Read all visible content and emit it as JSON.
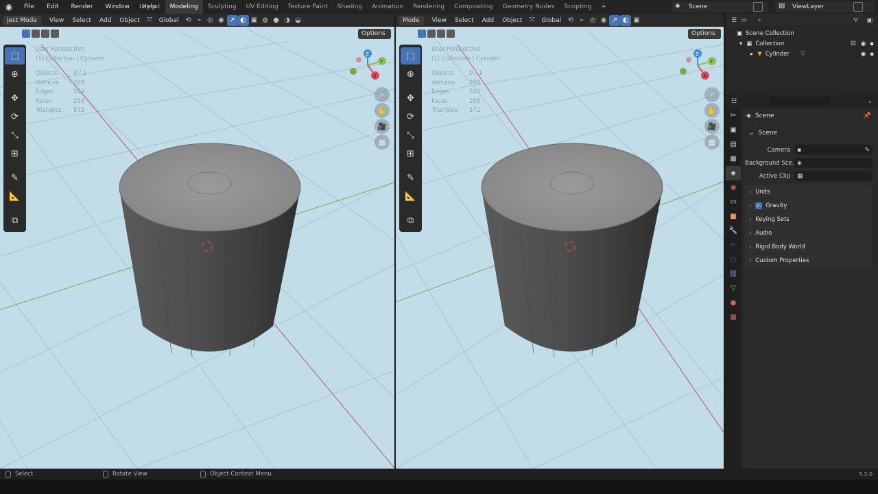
{
  "menu": [
    "File",
    "Edit",
    "Render",
    "Window",
    "Help"
  ],
  "workspaces": [
    "Layout",
    "Modeling",
    "Sculpting",
    "UV Editing",
    "Texture Paint",
    "Shading",
    "Animation",
    "Rendering",
    "Compositing",
    "Geometry Nodes",
    "Scripting",
    "+"
  ],
  "active_workspace": "Modeling",
  "scene_name": "Scene",
  "view_layer": "ViewLayer",
  "viewport_left": {
    "mode": "ject Mode",
    "view": "View",
    "select": "Select",
    "add": "Add",
    "object": "Object",
    "orientation": "Global",
    "options": "Options",
    "perspective": "User Perspective",
    "collection": "(1) Collection | Cylinder",
    "stats": [
      {
        "k": "Objects",
        "v": "0 / 1"
      },
      {
        "k": "Vertices",
        "v": "288"
      },
      {
        "k": "Edges",
        "v": "544"
      },
      {
        "k": "Faces",
        "v": "258"
      },
      {
        "k": "Triangles",
        "v": "572"
      }
    ]
  },
  "viewport_right": {
    "mode": "Mode",
    "view": "View",
    "select": "Select",
    "add": "Add",
    "object": "Object",
    "orientation": "Global",
    "options": "Options",
    "perspective": "User Perspective",
    "collection": "(1) Collection | Cylinder",
    "stats": [
      {
        "k": "Objects",
        "v": "0 / 1"
      },
      {
        "k": "Vertices",
        "v": "288"
      },
      {
        "k": "Edges",
        "v": "544"
      },
      {
        "k": "Faces",
        "v": "258"
      },
      {
        "k": "Triangles",
        "v": "572"
      }
    ]
  },
  "outliner": {
    "scene_collection": "Scene Collection",
    "collection": "Collection",
    "object": "Cylinder"
  },
  "properties": {
    "context": "Scene",
    "section": "Scene",
    "camera_label": "Camera",
    "background_label": "Background Sce...",
    "active_clip_label": "Active Clip",
    "panels": [
      "Units",
      "Gravity",
      "Keying Sets",
      "Audio",
      "Rigid Body World",
      "Custom Properties"
    ]
  },
  "status": {
    "select": "Select",
    "rotate": "Rotate View",
    "context_menu": "Object Context Menu",
    "version": "3.3.0"
  },
  "colors": {
    "accent": "#4772b3",
    "viewport_bg": "#c3dcea",
    "x_axis": "#e0475c",
    "y_axis": "#8ec14d",
    "z_axis": "#3b8fe0"
  }
}
